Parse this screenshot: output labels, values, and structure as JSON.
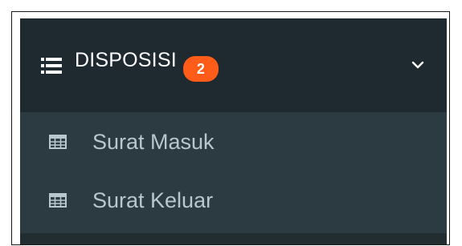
{
  "menu": {
    "header": {
      "icon": "list-icon",
      "label": "DISPOSISI",
      "badge": "2",
      "chevron_icon": "chevron-down-icon"
    },
    "items": [
      {
        "icon": "table-icon",
        "label": "Surat Masuk"
      },
      {
        "icon": "table-icon",
        "label": "Surat Keluar"
      }
    ]
  },
  "colors": {
    "header_bg": "#1f2a30",
    "submenu_bg": "#2c3b41",
    "badge_bg": "#ff5c1a",
    "header_text": "#ffffff",
    "submenu_text": "#b8c7ce"
  }
}
